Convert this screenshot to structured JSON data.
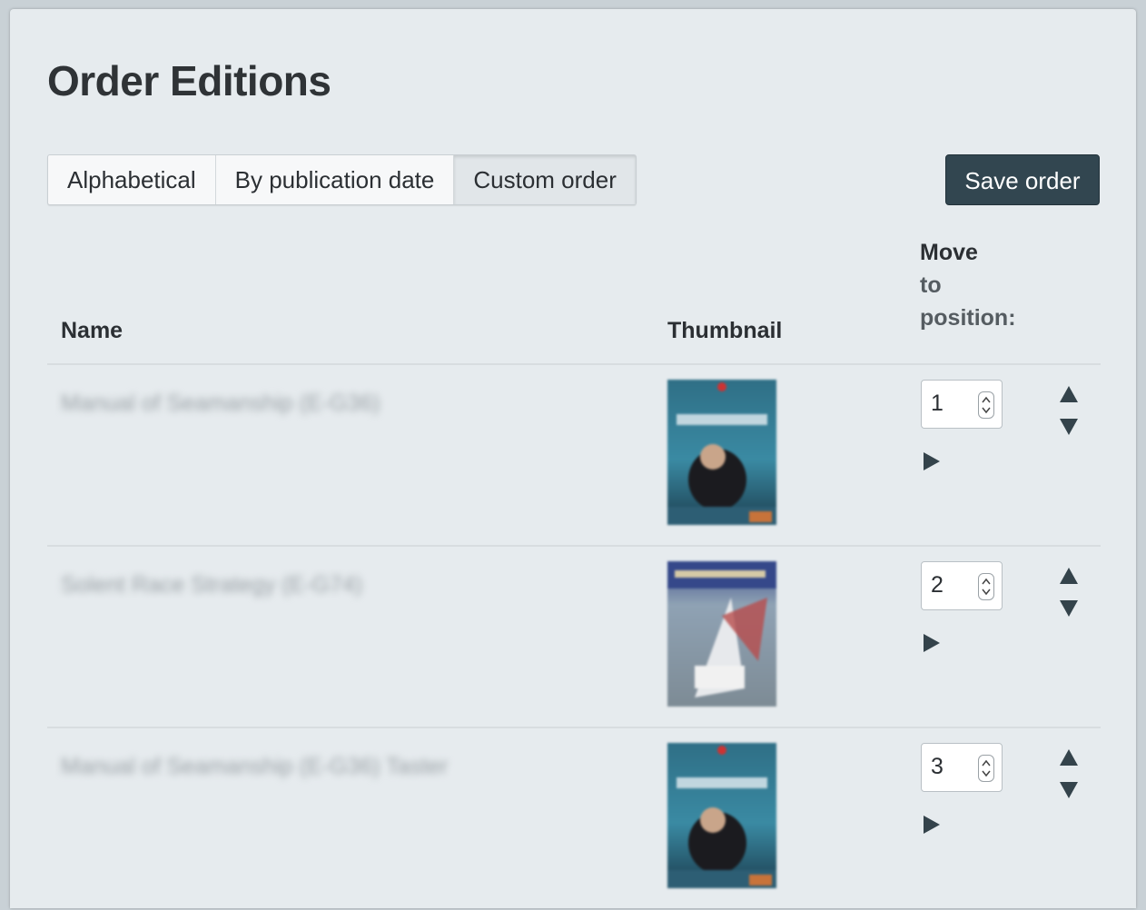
{
  "page": {
    "title": "Order Editions"
  },
  "sort_tabs": [
    {
      "label": "Alphabetical",
      "active": false
    },
    {
      "label": "By publication date",
      "active": false
    },
    {
      "label": "Custom order",
      "active": true
    }
  ],
  "save_button": {
    "label": "Save order"
  },
  "table": {
    "headers": {
      "name": "Name",
      "thumbnail": "Thumbnail",
      "move_line1": "Move",
      "move_line2": "to",
      "move_line3": "position:"
    },
    "rows": [
      {
        "name": "Manual of Seamanship (E-G36)",
        "position": "1",
        "thumb": "seamanship-cover"
      },
      {
        "name": "Solent Race Strategy (E-G74)",
        "position": "2",
        "thumb": "solent-race-cover"
      },
      {
        "name": "Manual of Seamanship (E-G36) Taster",
        "position": "3",
        "thumb": "seamanship-cover"
      }
    ]
  },
  "icons": {
    "move_up": "triangle-up-icon",
    "move_down": "triangle-down-icon",
    "move_to": "triangle-right-icon",
    "spinner": "number-spinner-icon"
  },
  "colors": {
    "primary_button": "#324650",
    "background": "#e6ebee",
    "arrow": "#34434b"
  }
}
